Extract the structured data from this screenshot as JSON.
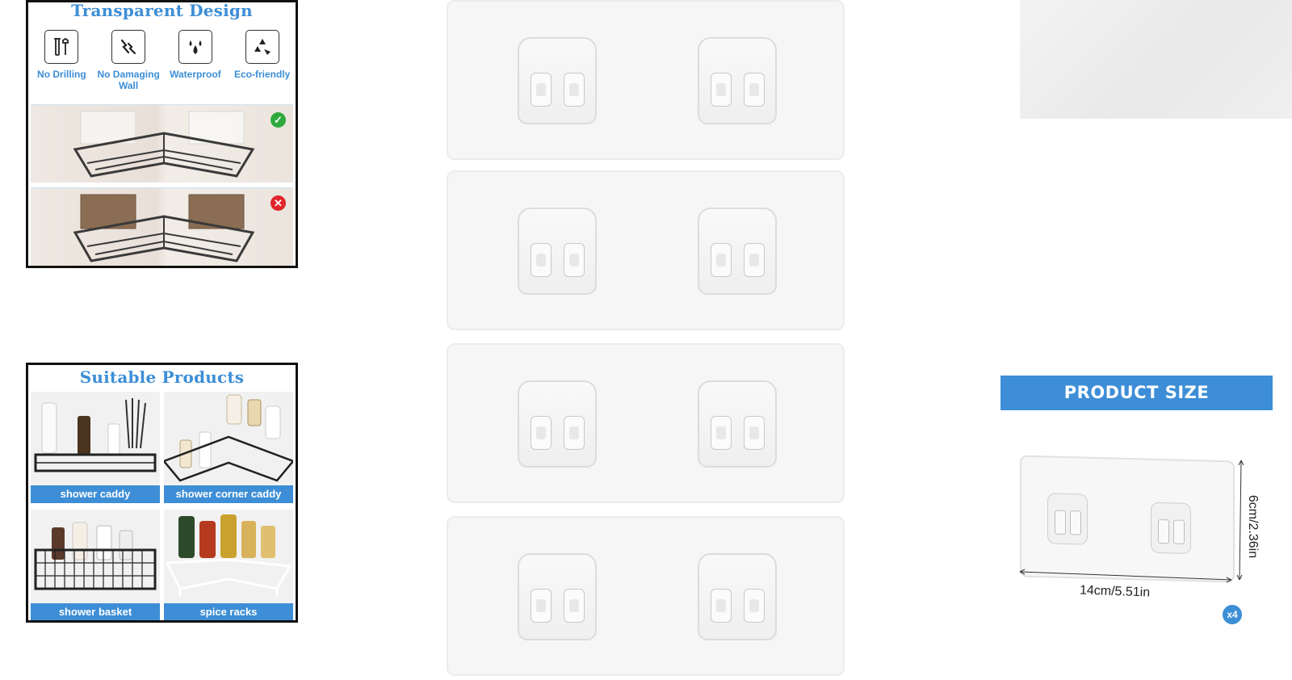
{
  "transparent_card": {
    "title": "Transparent Design",
    "features": [
      {
        "label": "No Drilling",
        "icon": "tools-icon"
      },
      {
        "label": "No Damaging\nWall",
        "icon": "broken-wall-icon"
      },
      {
        "label": "Waterproof",
        "icon": "water-drops-icon"
      },
      {
        "label": "Eco-friendly",
        "icon": "recycle-icon"
      }
    ],
    "comparison": [
      {
        "result": "good",
        "icon": "check-circle-icon",
        "color": "#2eaa3c"
      },
      {
        "result": "bad",
        "icon": "x-circle-icon",
        "color": "#e0262c"
      }
    ]
  },
  "suitable_card": {
    "title": "Suitable Products",
    "products": [
      {
        "label": "shower caddy"
      },
      {
        "label": "shower corner caddy"
      },
      {
        "label": "shower basket"
      },
      {
        "label": "spice racks"
      }
    ]
  },
  "product_size": {
    "header": "PRODUCT SIZE",
    "width": "14cm/5.51in",
    "height": "6cm/2.36in",
    "quantity": "x4"
  },
  "colors": {
    "accent_blue": "#3d8ed6",
    "plate_fill": "#f6f6f6",
    "card_border": "#111111"
  }
}
